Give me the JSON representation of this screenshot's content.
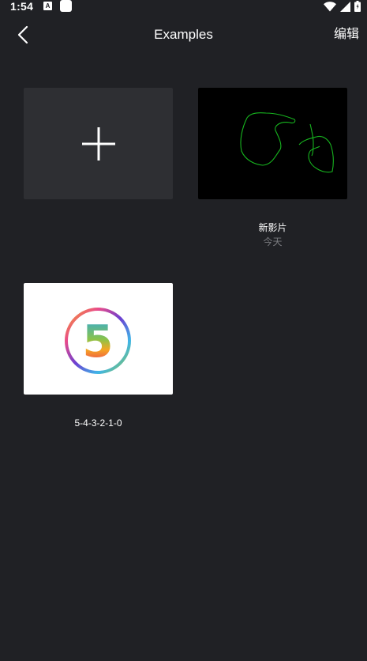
{
  "status_bar": {
    "time": "1:54",
    "notification_icons": [
      "a-icon",
      "square-icon"
    ],
    "right_icons": [
      "wifi-icon",
      "signal-icon",
      "battery-icon"
    ]
  },
  "app_bar": {
    "title": "Examples",
    "edit_label": "编辑"
  },
  "projects": [
    {
      "kind": "new",
      "icon": "plus-icon"
    },
    {
      "kind": "project",
      "name": "新影片",
      "date": "今天"
    },
    {
      "kind": "project",
      "name": "5-4-3-2-1-0",
      "thumbnail_text": "5"
    }
  ],
  "colors": {
    "background": "#202125",
    "add_card": "#2e2f33",
    "sketch_stroke": "#17b51f",
    "subtext": "#7b7c80"
  }
}
